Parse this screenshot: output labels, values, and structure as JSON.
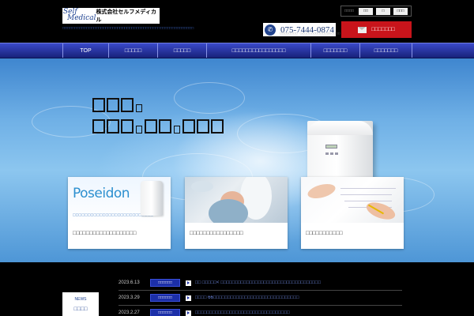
{
  "header": {
    "logo_line1": "Self",
    "logo_line2": "Medical",
    "company": "株式会社セルフメディカル",
    "tagline": "□□□□□□□□□□□□□□□□□□□□□□□□□□□□□□□□□□□□□□□□□□□□□□□□□□□□□□□",
    "font_size": {
      "label": "□□□□",
      "options": [
        "□□",
        "□",
        "□□□"
      ]
    },
    "phone": {
      "number": "075-7444-0874",
      "sub": "□□□□□□□□　□□□□□□□□□□□□□□□□□□"
    },
    "contact_label": "□□□□□□□"
  },
  "nav": {
    "items": [
      "TOP",
      "□□□□□",
      "□□□□□",
      "□□□□□□□□□□□□□□□□",
      "□□□□□□□",
      "□□□□□□□"
    ]
  },
  "hero": {
    "headline_line1": "□□□□□",
    "headline_line2": "□□□□□□□□□□□"
  },
  "cards": [
    {
      "brand": "Poseidon",
      "brand_sub": "□□□□□□□□□□□□□□□□□□□□□□□□□□□",
      "caption": "□□□□□□□□□□□□□□□□□□□"
    },
    {
      "caption": "□□□□□□□□□□□□□□□□"
    },
    {
      "caption": "□□□□□□□□□□□"
    }
  ],
  "news": {
    "label_en": "NEWS",
    "label_ja": "□□□□",
    "items": [
      {
        "date": "2023.6.13",
        "category": "□□□□□□",
        "title": "□□ □□□□□< □□□□□□□□□□□□□□□□□□□□□□□□□□□□□□□□□□□"
      },
      {
        "date": "2023.3.29",
        "category": "□□□□□□",
        "title": "□□□□ 66□□□□□□□□□□□□□□□□□□□□□□□□□□□□□□"
      },
      {
        "date": "2023.2.27",
        "category": "□□□□□□",
        "title": "□□□□□□□□□□□□□□□□□□□□□□□□□□□□□□□□□"
      }
    ]
  }
}
